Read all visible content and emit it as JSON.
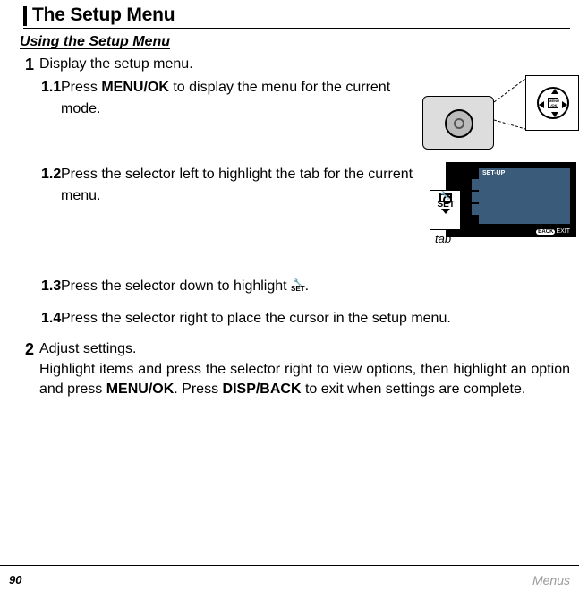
{
  "header": {
    "title": "The Setup Menu"
  },
  "subheading": "Using the Setup Menu",
  "steps": {
    "s1": {
      "num": "1",
      "title": "Display the setup menu.",
      "sub": {
        "s11": {
          "num": "1.1",
          "pre": "Press ",
          "kw": "MENU/OK",
          "post": " to display the menu for the current mode."
        },
        "s12": {
          "num": "1.2",
          "text": "Press the selector left to highlight the tab for the current menu."
        },
        "s13": {
          "num": "1.3",
          "pre": "Press the selector down to highlight ",
          "post": "."
        },
        "s14": {
          "num": "1.4",
          "text": "Press the selector right to place the cursor in the setup menu."
        }
      }
    },
    "s2": {
      "num": "2",
      "title": "Adjust settings.",
      "para_a": "Highlight items and press the selector right to view options, then highlight an option and press ",
      "kw1": "MENU/OK",
      "mid": ".  Press ",
      "kw2": "DISP/BACK",
      "para_b": " to exit when settings are complete."
    }
  },
  "illus": {
    "menuok_label": "MENU /OK",
    "screen_title": "SET-UP",
    "screen_exit_pill": "BACK",
    "screen_exit_text": "EXIT",
    "set_icon_tool": "🔧",
    "set_icon_text": "SET",
    "tab_label": "tab"
  },
  "footer": {
    "page": "90",
    "category": "Menus"
  }
}
